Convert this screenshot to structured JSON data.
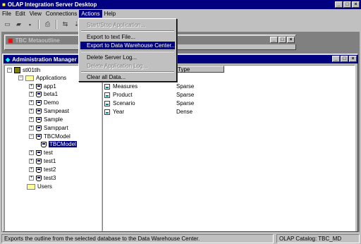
{
  "app": {
    "title": "OLAP Integration Server Desktop"
  },
  "menu": {
    "file": "File",
    "edit": "Edit",
    "view": "View",
    "connections": "Connections",
    "actions": "Actions",
    "help": "Help"
  },
  "actions_menu": {
    "start_stop": "Start/Stop Application...",
    "export_text": "Export to text File...",
    "export_dwc": "Export to Data Warehouse Center...",
    "delete_log": "Delete Server Log...",
    "delete_app_log": "Delete Application Log...",
    "clear_all": "Clear all Data..."
  },
  "metaoutline": {
    "title": "TBC Metaoutline"
  },
  "admin": {
    "title": "Administration Manager",
    "tree": {
      "server": "stl01tlh",
      "applications": "Applications",
      "apps": [
        "app1",
        "beta1",
        "Demo",
        "Sampeast",
        "Sample",
        "Samppart",
        "TBCModel"
      ],
      "tbcmodel_db": "TBCModel",
      "apps2": [
        "test",
        "test1",
        "test2",
        "test3"
      ],
      "users": "Users"
    },
    "columns": {
      "type": "Type"
    },
    "rows": [
      {
        "name": "Measures",
        "type": "Sparse"
      },
      {
        "name": "Product",
        "type": "Sparse"
      },
      {
        "name": "Scenario",
        "type": "Sparse"
      },
      {
        "name": "Year",
        "type": "Dense"
      }
    ]
  },
  "status": {
    "message": "Exports the outline from the selected database to the Data Warehouse Center.",
    "catalog": "OLAP Catalog: TBC_MD"
  }
}
